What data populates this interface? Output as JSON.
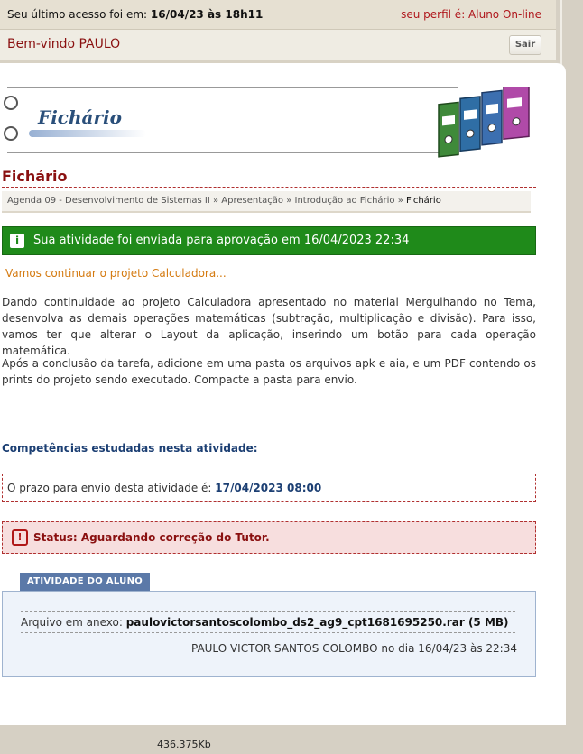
{
  "topbar": {
    "last_access_label": "Seu último acesso foi em:",
    "last_access_value": "16/04/23 às 18h11",
    "profile": "seu perfil é: Aluno On-line"
  },
  "welcome": {
    "text": "Bem-vindo PAULO",
    "logout_label": "Sair"
  },
  "banner": {
    "title": "Fichário"
  },
  "page": {
    "title": "Fichário"
  },
  "breadcrumb": {
    "items": [
      "Agenda 09 - Desenvolvimento de Sistemas II",
      "Apresentação",
      "Introdução ao Fichário"
    ],
    "separator": "»",
    "current": "Fichário"
  },
  "success": {
    "icon": "info-icon",
    "text": "Sua atividade foi enviada para aprovação em 16/04/2023 22:34"
  },
  "subtitle": "Vamos continuar o projeto Calculadora...",
  "paragraphs": [
    "Dando continuidade ao projeto Calculadora apresentado no material Mergulhando no Tema, desenvolva as demais operações matemáticas (subtração, multiplicação e divisão). Para isso, vamos ter que alterar o Layout da aplicação, inserindo um botão para cada operação matemática.",
    "Após a conclusão da tarefa, adicione em uma pasta os arquivos apk e aia, e um PDF contendo os prints do projeto sendo executado. Compacte a pasta para envio."
  ],
  "competencias": "Competências estudadas nesta atividade:",
  "prazo": {
    "label": "O prazo para envio desta atividade é:",
    "value": "17/04/2023 08:00"
  },
  "status": {
    "icon": "alert-icon",
    "text": "Status: Aguardando correção do Tutor."
  },
  "student": {
    "tab_label": "ATIVIDADE DO ALUNO",
    "attachment_label": "Arquivo em anexo:",
    "attachment_name": "paulovictorsantoscolombo_ds2_ag9_cpt1681695250.rar (5 MB)",
    "submitted_by": "PAULO VICTOR SANTOS COLOMBO no dia 16/04/23 às 22:34"
  },
  "footer": {
    "size": "436.375Kb"
  },
  "colors": {
    "accent_red": "#8a1010",
    "success_green": "#1f8a1a",
    "link_blue": "#1c3f73",
    "warning_orange": "#d47a10"
  }
}
